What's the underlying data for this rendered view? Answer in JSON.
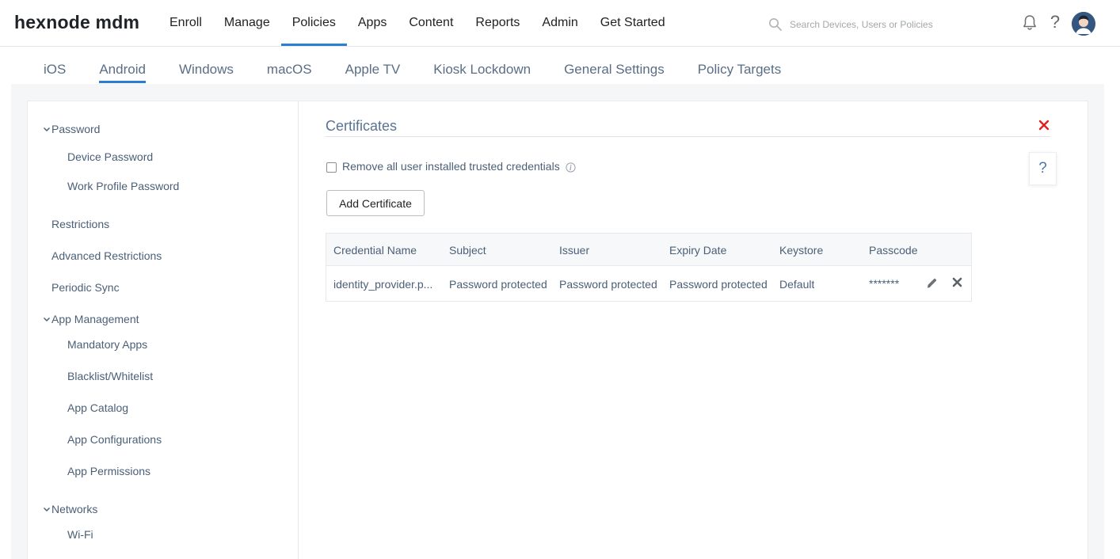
{
  "brand": {
    "logo": "hexnode mdm",
    "accent": "#2a7fd4"
  },
  "nav": {
    "items": [
      {
        "label": "Enroll"
      },
      {
        "label": "Manage"
      },
      {
        "label": "Policies",
        "active": true
      },
      {
        "label": "Apps"
      },
      {
        "label": "Content"
      },
      {
        "label": "Reports"
      },
      {
        "label": "Admin"
      },
      {
        "label": "Get Started"
      }
    ],
    "search_placeholder": "Search Devices, Users or Policies",
    "help_label": "?"
  },
  "os_tabs": [
    {
      "label": "iOS"
    },
    {
      "label": "Android",
      "active": true
    },
    {
      "label": "Windows"
    },
    {
      "label": "macOS"
    },
    {
      "label": "Apple TV"
    },
    {
      "label": "Kiosk Lockdown"
    },
    {
      "label": "General Settings"
    },
    {
      "label": "Policy Targets"
    }
  ],
  "sidebar": {
    "password": {
      "label": "Password",
      "items": [
        "Device Password",
        "Work Profile Password"
      ]
    },
    "restrictions": "Restrictions",
    "advanced_restrictions": "Advanced Restrictions",
    "periodic_sync": "Periodic Sync",
    "app_management": {
      "label": "App Management",
      "items": [
        "Mandatory Apps",
        "Blacklist/Whitelist",
        "App Catalog",
        "App Configurations",
        "App Permissions"
      ]
    },
    "networks": {
      "label": "Networks",
      "items": [
        "Wi-Fi"
      ]
    }
  },
  "panel": {
    "title": "Certificates",
    "help_label": "?",
    "checkbox_label": "Remove all user installed trusted credentials",
    "add_button": "Add Certificate",
    "table": {
      "headers": [
        "Credential Name",
        "Subject",
        "Issuer",
        "Expiry Date",
        "Keystore",
        "Passcode"
      ],
      "rows": [
        [
          "identity_provider.p...",
          "Password protected",
          "Password protected",
          "Password protected",
          "Default",
          "*******"
        ]
      ]
    }
  }
}
